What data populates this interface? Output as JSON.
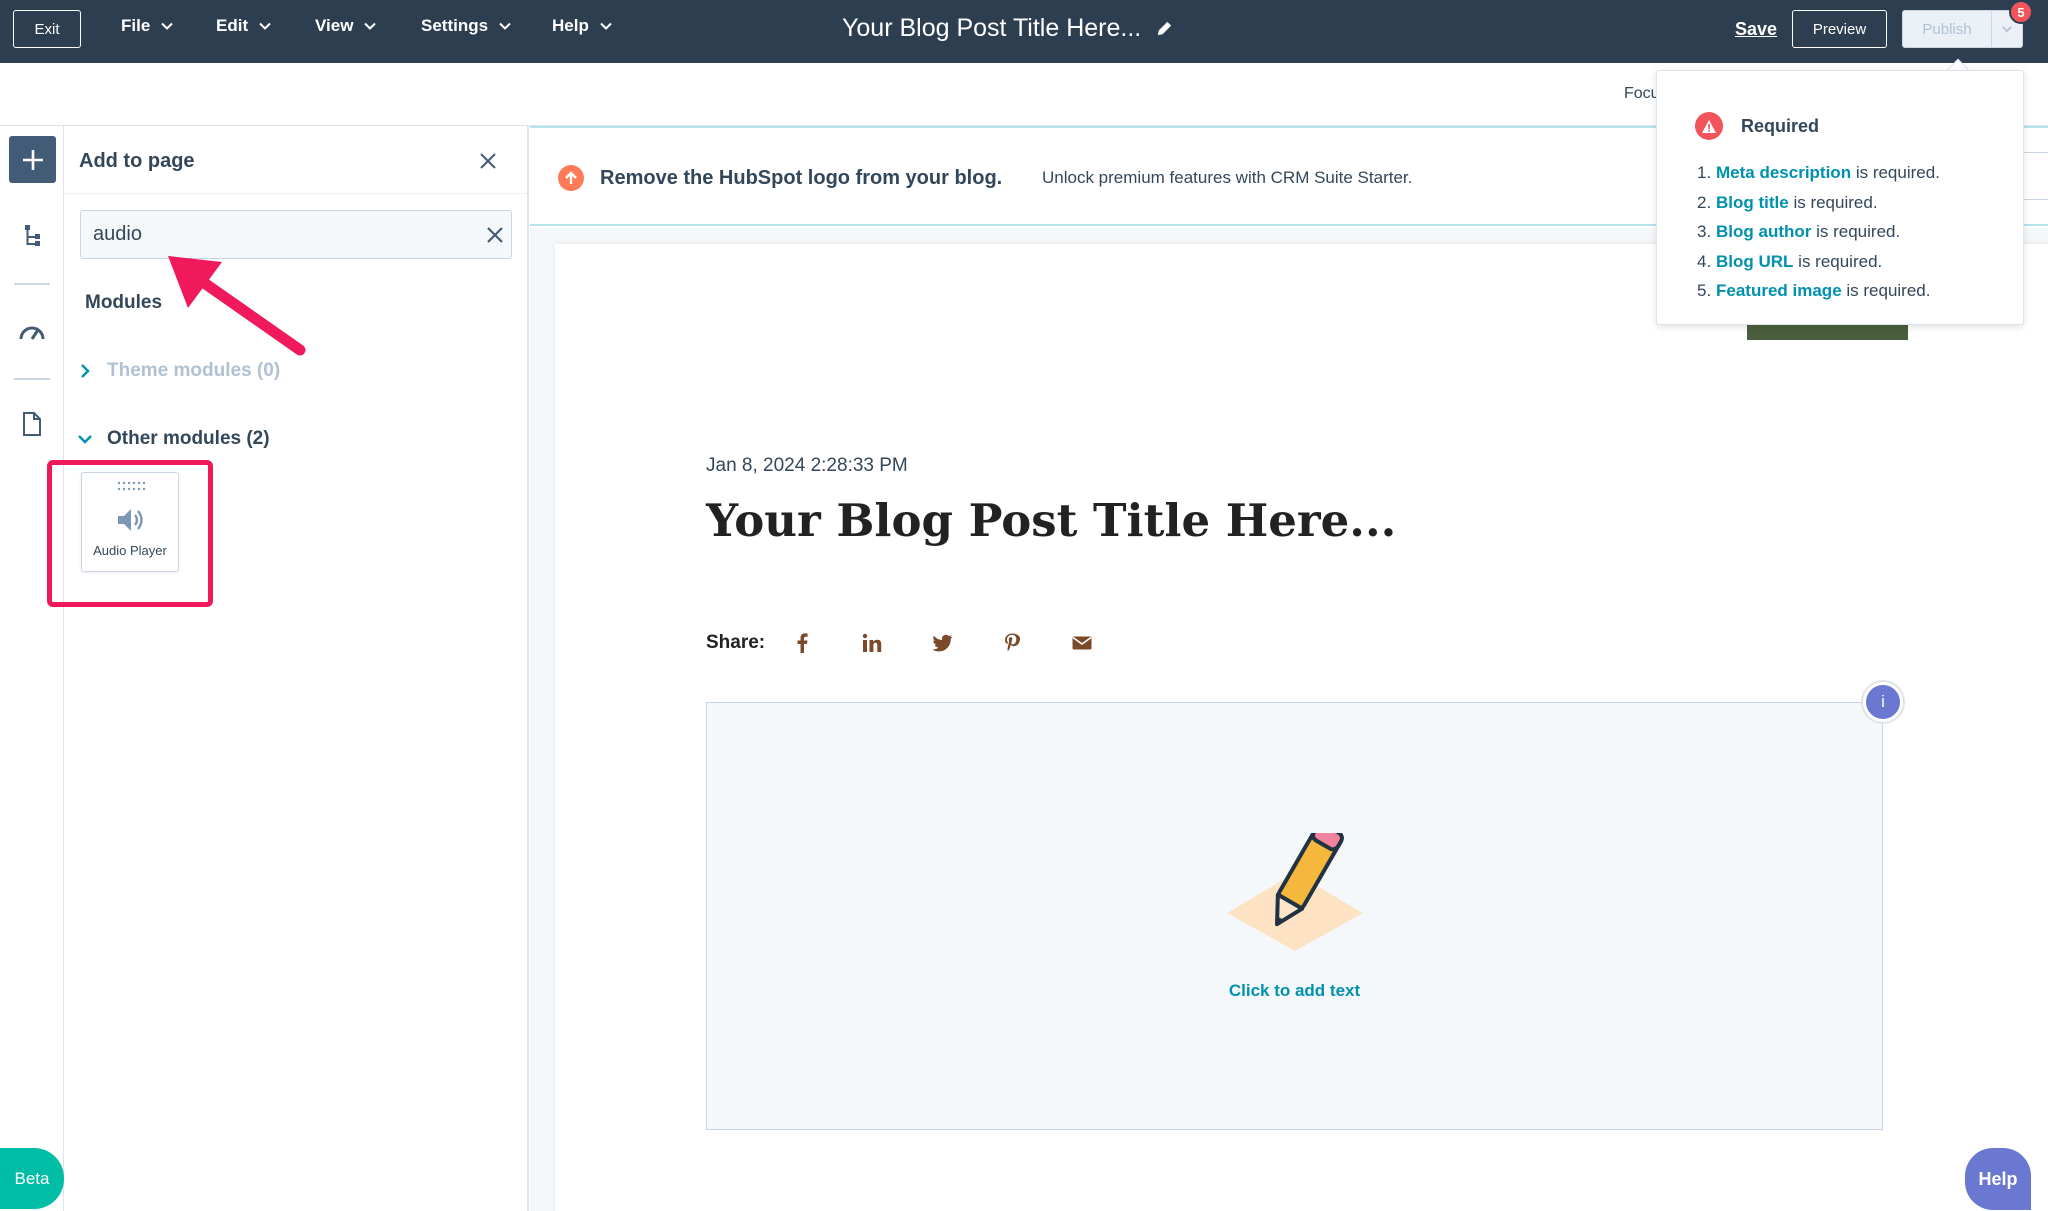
{
  "topbar": {
    "exit_label": "Exit",
    "menus": [
      {
        "label": "File"
      },
      {
        "label": "Edit"
      },
      {
        "label": "View"
      },
      {
        "label": "Settings"
      },
      {
        "label": "Help"
      }
    ],
    "doc_title": "Your Blog Post Title Here...",
    "save_label": "Save",
    "preview_label": "Preview",
    "publish_label": "Publish",
    "publish_badge": "5"
  },
  "subbar": {
    "focus_label": "Focu"
  },
  "rail": {
    "icons": [
      "plus-icon",
      "tree-icon",
      "speedometer-icon",
      "document-icon"
    ],
    "beta_label": "Beta"
  },
  "panel": {
    "title": "Add to page",
    "search_value": "audio",
    "section_label": "Modules",
    "groups": [
      {
        "label": "Theme modules (0)",
        "expanded": false
      },
      {
        "label": "Other modules (2)",
        "expanded": true
      }
    ],
    "module": {
      "label": "Audio Player",
      "icon": "speaker-icon"
    }
  },
  "banner": {
    "bold_text": "Remove the HubSpot logo from your blog.",
    "text": "Unlock premium features with CRM Suite Starter."
  },
  "post": {
    "date": "Jan 8, 2024 2:28:33 PM",
    "title": "Your Blog Post Title Here...",
    "share_label": "Share:",
    "share_icons": [
      "facebook-icon",
      "linkedin-icon",
      "twitter-icon",
      "pinterest-icon",
      "email-icon"
    ],
    "click_to_add": "Click to add text",
    "info_badge": "i"
  },
  "popover": {
    "title": "Required",
    "items": [
      {
        "num": "1.",
        "link": "Meta description",
        "suffix": " is required."
      },
      {
        "num": "2.",
        "link": "Blog title",
        "suffix": " is required."
      },
      {
        "num": "3.",
        "link": "Blog author",
        "suffix": " is required."
      },
      {
        "num": "4.",
        "link": "Blog URL",
        "suffix": " is required."
      },
      {
        "num": "5.",
        "link": "Featured image",
        "suffix": " is required."
      }
    ]
  },
  "help_label": "Help",
  "colors": {
    "topbar": "#2d3e50",
    "accent_teal": "#0091ae",
    "highlight_pink": "#f0195b",
    "beta_green": "#00bda5",
    "help_purple": "#6a78d1",
    "alert_red": "#f2545b",
    "orange": "#ff7a59"
  }
}
